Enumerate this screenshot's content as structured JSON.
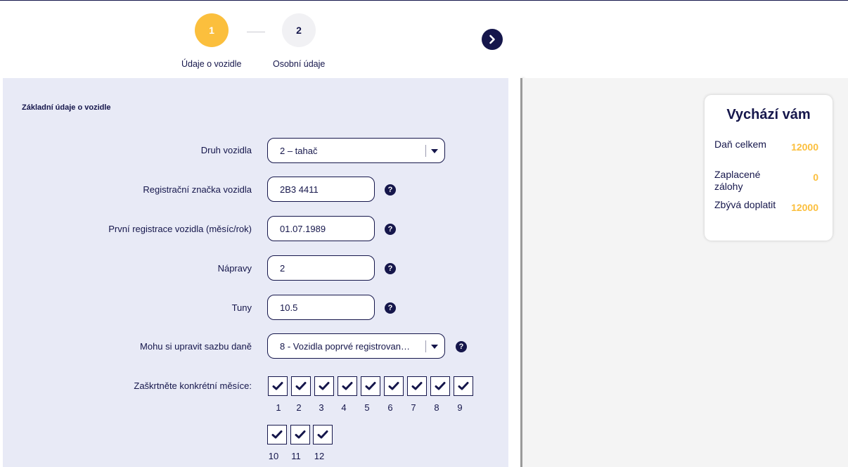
{
  "stepper": {
    "steps": [
      {
        "number": "1",
        "label": "Údaje o vozidle",
        "state": "active"
      },
      {
        "number": "2",
        "label": "Osobní údaje",
        "state": "inactive"
      }
    ],
    "next_icon": "chevron-right-icon"
  },
  "form": {
    "section_title": "Základní údaje o vozidle",
    "fields": {
      "druh_vozidla": {
        "label": "Druh vozidla",
        "value": "2 – tahač"
      },
      "registracni_znacka": {
        "label": "Registrační značka vozidla",
        "value": "2B3 4411"
      },
      "prvni_registrace": {
        "label": "První registrace vozidla (měsíc/rok)",
        "value": "01.07.1989"
      },
      "napravy": {
        "label": "Nápravy",
        "value": "2"
      },
      "tuny": {
        "label": "Tuny",
        "value": "10.5"
      },
      "sazba_dane": {
        "label": "Mohu si upravit sazbu daně",
        "value": "8 - Vozidla poprvé registrovaná..."
      }
    },
    "help_icon": "?",
    "months": {
      "label": "Zaškrtněte konkrétní měsíce:",
      "items": [
        {
          "number": "1",
          "checked": true
        },
        {
          "number": "2",
          "checked": true
        },
        {
          "number": "3",
          "checked": true
        },
        {
          "number": "4",
          "checked": true
        },
        {
          "number": "5",
          "checked": true
        },
        {
          "number": "6",
          "checked": true
        },
        {
          "number": "7",
          "checked": true
        },
        {
          "number": "8",
          "checked": true
        },
        {
          "number": "9",
          "checked": true
        },
        {
          "number": "10",
          "checked": true
        },
        {
          "number": "11",
          "checked": true
        },
        {
          "number": "12",
          "checked": true
        }
      ]
    }
  },
  "summary": {
    "title": "Vychází vám",
    "rows": [
      {
        "label": "Daň celkem",
        "value": "12000"
      },
      {
        "label": "Zaplacené zálohy",
        "value": "0"
      },
      {
        "label": "Zbývá doplatit",
        "value": "12000"
      }
    ]
  },
  "colors": {
    "accent": "#fbbf3d",
    "primary": "#15164b",
    "panel": "#e8eaf6"
  }
}
